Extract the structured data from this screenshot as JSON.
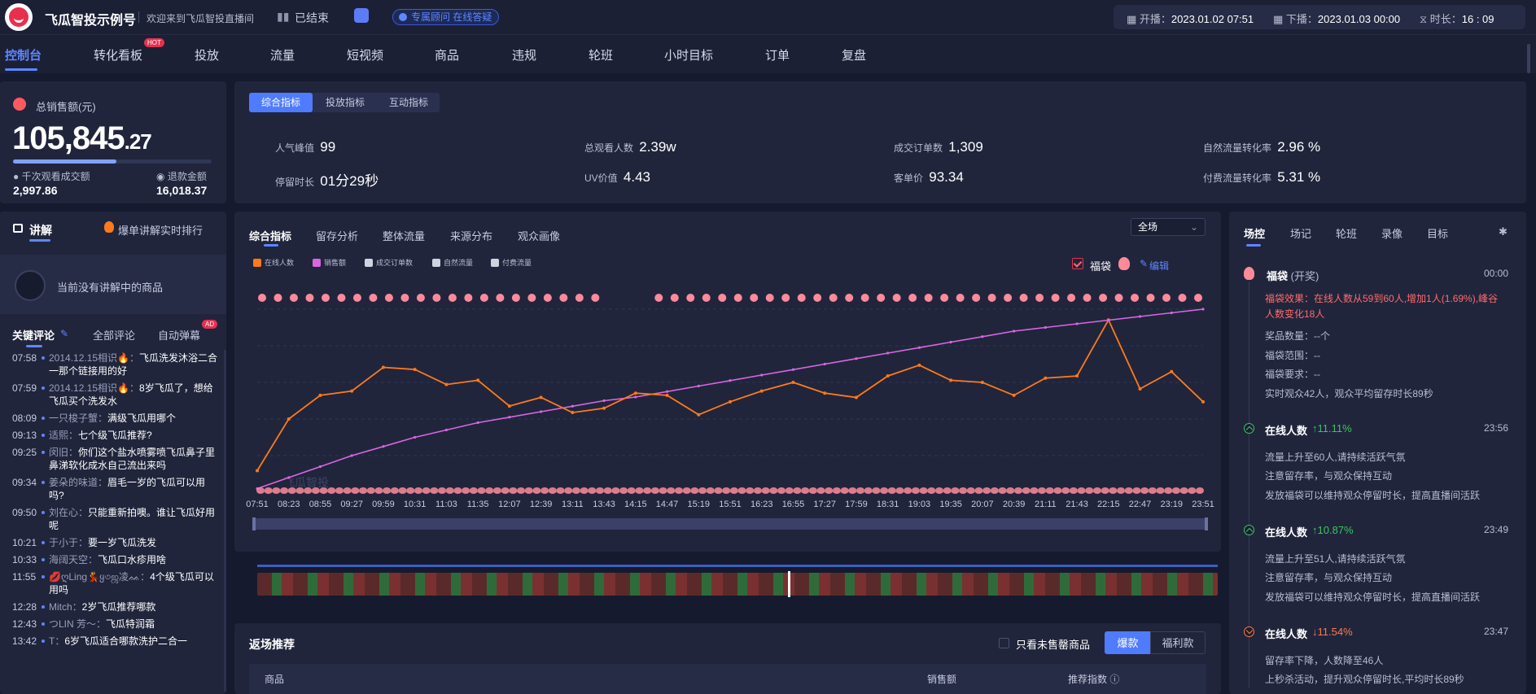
{
  "header": {
    "brand": "飞瓜智投示例号",
    "welcome": "欢迎来到飞瓜智投直播间",
    "status": "已结束",
    "advisor": "专属顾问 在线答疑",
    "start_label": "开播：",
    "start_value": "2023.01.02 07:51",
    "end_label": "下播：",
    "end_value": "2023.01.03 00:00",
    "duration_label": "时长：",
    "duration_value": "16 : 09"
  },
  "nav": {
    "items": [
      "控制台",
      "转化看板",
      "投放",
      "流量",
      "短视频",
      "商品",
      "违规",
      "轮班",
      "小时目标",
      "订单",
      "复盘"
    ],
    "hot_badge": "HOT"
  },
  "sales": {
    "label": "总销售额(元)",
    "value_int": "105,845",
    "value_dec": ".27",
    "progress": 0.52,
    "gpm_label": "千次观看成交额",
    "gpm_value": "2,997.86",
    "refund_label": "退款金额",
    "refund_value": "16,018.37"
  },
  "metrics": {
    "tabs": [
      "综合指标",
      "投放指标",
      "互动指标"
    ],
    "items": [
      {
        "label": "人气峰值",
        "value": "99"
      },
      {
        "label": "总观看人数",
        "value": "2.39w"
      },
      {
        "label": "成交订单数",
        "value": "1,309"
      },
      {
        "label": "自然流量转化率",
        "value": "2.96 %"
      },
      {
        "label": "停留时长",
        "value": "01分29秒"
      },
      {
        "label": "UV价值",
        "value": "4.43"
      },
      {
        "label": "客单价",
        "value": "93.34"
      },
      {
        "label": "付费流量转化率",
        "value": "5.31 %"
      }
    ]
  },
  "lecture": {
    "title": "讲解",
    "rank_link": "爆单讲解实时排行",
    "empty": "当前没有讲解中的商品"
  },
  "comments": {
    "tabs": [
      "关键评论",
      "全部评论",
      "自动弹幕"
    ],
    "ad_badge": "AD",
    "items": [
      {
        "time": "07:58",
        "user": "2014.12.15相识🔥：",
        "msg": "飞瓜洗发沐浴二合一那个链接用的好"
      },
      {
        "time": "07:59",
        "user": "2014.12.15相识🔥：",
        "msg": "8岁飞瓜了，想给飞瓜买个洗发水"
      },
      {
        "time": "08:09",
        "user": "一只梭子蟹：",
        "msg": "满级飞瓜用哪个"
      },
      {
        "time": "09:13",
        "user": "适熙：",
        "msg": "七个级飞瓜推荐?"
      },
      {
        "time": "09:25",
        "user": "闵旧：",
        "msg": "你们这个盐水喷雾喷飞瓜鼻子里鼻涕软化成水自己流出来吗"
      },
      {
        "time": "09:34",
        "user": "姜朵的味道：",
        "msg": "眉毛一岁的飞瓜可以用吗?"
      },
      {
        "time": "09:50",
        "user": "刘在心：",
        "msg": "只能重新拍噢。谁让飞瓜好用呢"
      },
      {
        "time": "10:21",
        "user": "于小于：",
        "msg": "要一岁飞瓜洗发"
      },
      {
        "time": "10:33",
        "user": "海阔天空：",
        "msg": "飞瓜口水疹用啥"
      },
      {
        "time": "11:55",
        "user": "💋ღLing💃ყ৩ஜ凌ᨐ：",
        "msg": "4个级飞瓜可以用吗"
      },
      {
        "time": "12:28",
        "user": "Mitch：",
        "msg": "2岁飞瓜推荐哪款"
      },
      {
        "time": "12:43",
        "user": "つLIN 芳～：",
        "msg": "飞瓜特润霜"
      },
      {
        "time": "13:42",
        "user": "T：",
        "msg": "6岁飞瓜适合哪款洗护二合一"
      }
    ]
  },
  "chart": {
    "tabs": [
      "综合指标",
      "留存分析",
      "整体流量",
      "来源分布",
      "观众画像"
    ],
    "select_value": "全场",
    "legend": [
      "在线人数",
      "销售额",
      "成交订单数",
      "自然流量",
      "付费流量"
    ],
    "legend_colors": [
      "#ff7a1a",
      "#d966e0",
      "#cfd3e0",
      "#cfd3e0",
      "#cfd3e0"
    ],
    "bag_label": "福袋",
    "edit_label": "编辑",
    "watermark": "飞瓜智投"
  },
  "chart_data": {
    "type": "line",
    "x": [
      "07:51",
      "08:23",
      "08:55",
      "09:27",
      "09:59",
      "10:31",
      "11:03",
      "11:35",
      "12:07",
      "12:39",
      "13:11",
      "13:43",
      "14:15",
      "14:47",
      "15:19",
      "15:51",
      "16:23",
      "16:55",
      "17:27",
      "17:59",
      "18:31",
      "19:03",
      "19:35",
      "20:07",
      "20:39",
      "21:11",
      "21:43",
      "22:15",
      "22:47",
      "23:19",
      "23:51"
    ],
    "series": [
      {
        "name": "在线人数",
        "values": [
          10,
          34,
          45,
          47,
          58,
          57,
          50,
          52,
          40,
          44,
          37,
          39,
          46,
          45,
          36,
          42,
          47,
          51,
          46,
          44,
          54,
          59,
          52,
          51,
          45,
          53,
          54,
          80,
          48,
          56,
          42
        ]
      },
      {
        "name": "销售额",
        "values": [
          2,
          8,
          14,
          20,
          25,
          30,
          34,
          38,
          41,
          44,
          47,
          50,
          52,
          55,
          58,
          61,
          64,
          67,
          70,
          73,
          76,
          79,
          82,
          85,
          88,
          90,
          92,
          94,
          96,
          98,
          100
        ]
      }
    ]
  },
  "right": {
    "tabs": [
      "场控",
      "场记",
      "轮班",
      "录像",
      "目标"
    ],
    "events": [
      {
        "title": "福袋",
        "sub": "(开奖)",
        "time": "00:00",
        "red": "福袋效果：在线人数从59到60人,增加1人(1.69%),峰谷人数变化18人",
        "lines": [
          "奖品数量：--个",
          "福袋范围：--",
          "福袋要求：--",
          "实时观众42人，观众平均留存时长89秒"
        ]
      },
      {
        "title": "在线人数",
        "delta": "↑11.11%",
        "dir": "up",
        "time": "23:56",
        "lines": [
          "流量上升至60人,请持续活跃气氛",
          "注意留存率，与观众保持互动",
          "发放福袋可以维持观众停留时长，提高直播间活跃"
        ]
      },
      {
        "title": "在线人数",
        "delta": "↑10.87%",
        "dir": "up",
        "time": "23:49",
        "lines": [
          "流量上升至51人,请持续活跃气氛",
          "注意留存率，与观众保持互动",
          "发放福袋可以维持观众停留时长，提高直播间活跃"
        ]
      },
      {
        "title": "在线人数",
        "delta": "↓11.54%",
        "dir": "down",
        "time": "23:47",
        "lines": [
          "留存率下降，人数降至46人",
          "上秒杀活动，提升观众停留时长,平均时长89秒"
        ]
      }
    ]
  },
  "bottom": {
    "title": "返场推荐",
    "checkbox_label": "只看未售罄商品",
    "seg": [
      "爆款",
      "福利款"
    ],
    "columns": [
      "商品",
      "销售额",
      "推荐指数"
    ]
  },
  "colors": {
    "accent": "#4f7cff",
    "online": "#ff7a1a",
    "sales": "#d966e0",
    "up": "#3ec45f",
    "down": "#ff7a45"
  }
}
